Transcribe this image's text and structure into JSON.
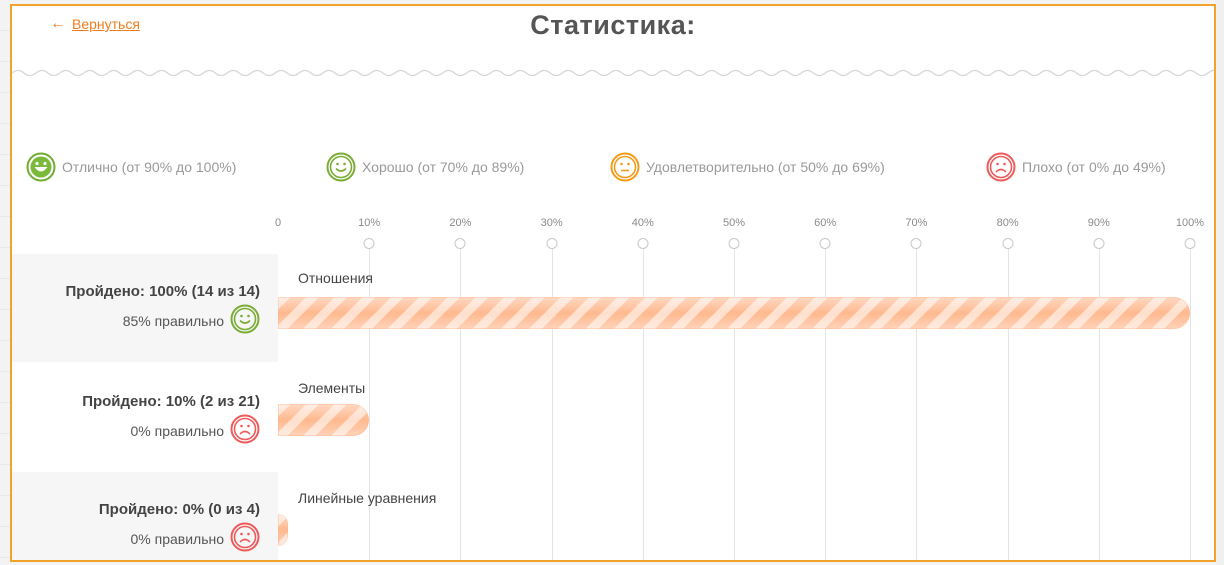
{
  "nav": {
    "back_label": "Вернуться"
  },
  "page": {
    "title": "Статистика:"
  },
  "legend": [
    {
      "label": "Отлично (от 90% до 100%)",
      "mood": "great",
      "color": "#6fac2f"
    },
    {
      "label": "Хорошо (от 70% до 89%)",
      "mood": "good",
      "color": "#7aad35"
    },
    {
      "label": "Удовлетворительно (от 50% до 69%)",
      "mood": "ok",
      "color": "#f39c1c"
    },
    {
      "label": "Плохо (от 0% до 49%)",
      "mood": "bad",
      "color": "#ef5b5b"
    }
  ],
  "axis": {
    "ticks": [
      "0",
      "10%",
      "20%",
      "30%",
      "40%",
      "50%",
      "60%",
      "70%",
      "80%",
      "90%",
      "100%"
    ]
  },
  "rows": [
    {
      "topic": "Отношения",
      "passed_label": "Пройдено: 100% (14 из 14)",
      "correct_label": "85% правильно",
      "progress_percent": 100,
      "mood": "good"
    },
    {
      "topic": "Элементы",
      "passed_label": "Пройдено: 10% (2 из 21)",
      "correct_label": "0% правильно",
      "progress_percent": 10,
      "mood": "bad"
    },
    {
      "topic": "Линейные уравнения",
      "passed_label": "Пройдено: 0% (0 из 4)",
      "correct_label": "0% правильно",
      "progress_percent": 0,
      "mood": "bad"
    }
  ]
}
